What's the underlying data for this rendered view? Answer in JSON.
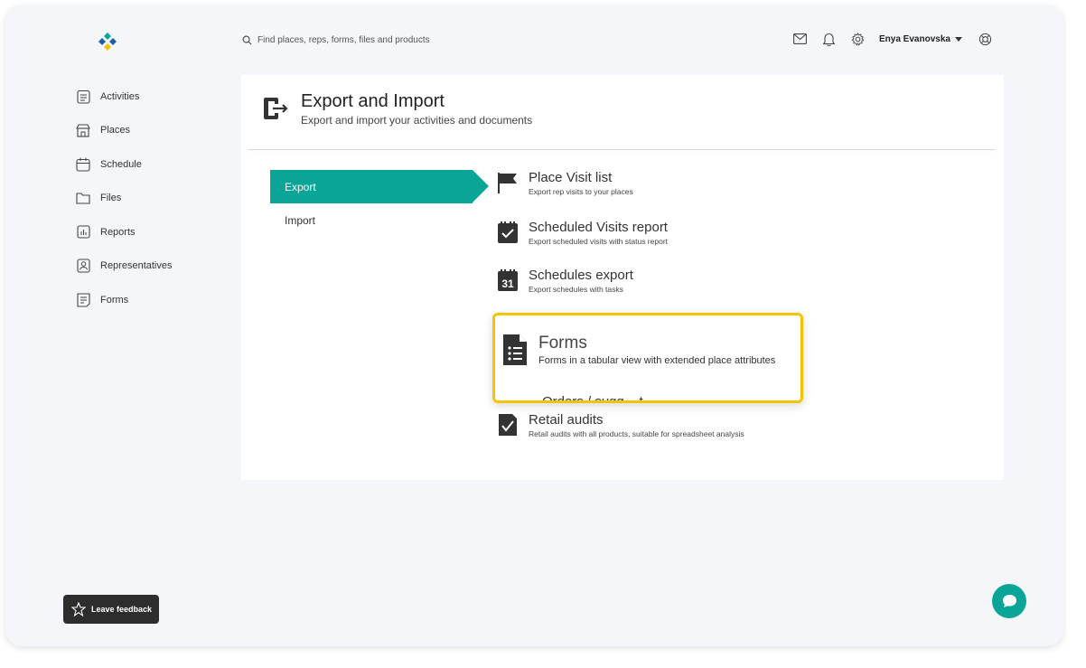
{
  "search": {
    "placeholder": "Find places, reps, forms, files and products"
  },
  "user": {
    "name": "Enya Evanovska"
  },
  "sidebar": {
    "items": [
      {
        "label": "Activities",
        "icon": "clipboard-icon"
      },
      {
        "label": "Places",
        "icon": "store-icon"
      },
      {
        "label": "Schedule",
        "icon": "calendar-icon"
      },
      {
        "label": "Files",
        "icon": "folder-icon"
      },
      {
        "label": "Reports",
        "icon": "chart-icon"
      },
      {
        "label": "Representatives",
        "icon": "person-badge-icon"
      },
      {
        "label": "Forms",
        "icon": "form-icon"
      }
    ]
  },
  "page": {
    "title": "Export and Import",
    "subtitle": "Export and import your activities and documents"
  },
  "tabs": [
    {
      "label": "Export",
      "active": true
    },
    {
      "label": "Import",
      "active": false
    }
  ],
  "exports": [
    {
      "title": "Place Visit list",
      "desc": "Export rep visits to your places",
      "icon": "flag-icon"
    },
    {
      "title": "Scheduled Visits report",
      "desc": "Export scheduled visits with status report",
      "icon": "calendar-check-icon"
    },
    {
      "title": "Schedules export",
      "desc": "Export schedules with tasks",
      "icon": "calendar-31-icon",
      "icon_text": "31"
    },
    {
      "title": "Retail audits",
      "desc": "Retail audits with all products, suitable for spreadsheet analysis",
      "icon": "document-check-icon"
    }
  ],
  "highlight": {
    "title": "Forms",
    "desc": "Forms in a tabular view with extended place attributes",
    "partial_next": "Orders / sugg... t"
  },
  "feedback": {
    "label": "Leave feedback"
  },
  "colors": {
    "accent": "#0aa596",
    "highlight": "#f5c400"
  }
}
